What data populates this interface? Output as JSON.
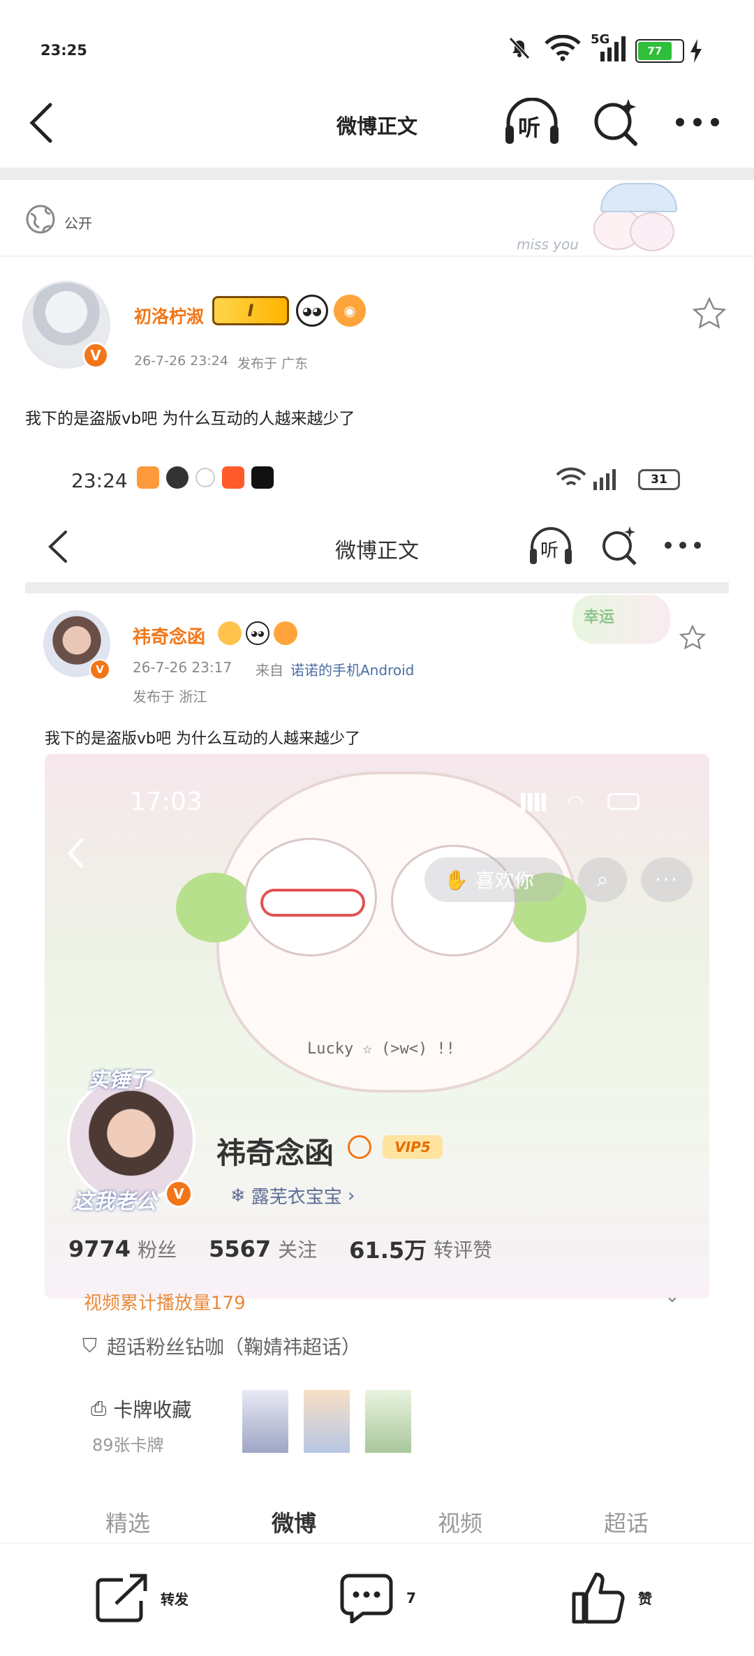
{
  "status_bar": {
    "time": "23:25",
    "network": "5G",
    "battery": "77"
  },
  "nav": {
    "title": "微博正文",
    "listen_label": "听"
  },
  "privacy": {
    "label": "公开",
    "sticker_text": "miss you"
  },
  "post": {
    "username": "初洛柠淑",
    "badge_level": "I",
    "timestamp": "26-7-26 23:24",
    "location": "发布于 广东",
    "text": "我下的是盗版vb吧 为什么互动的人越来越少了"
  },
  "inner": {
    "status_time": "23:24",
    "battery": "31",
    "nav_title": "微博正文",
    "listen_label": "听",
    "sticker_text": "幸运",
    "username": "祎奇念函",
    "timestamp": "26-7-26 23:17",
    "from_label": "来自",
    "device": "诺诺的手机Android",
    "location": "发布于 浙江",
    "text": "我下的是盗版vb吧 为什么互动的人越来越少了"
  },
  "profile": {
    "status_time": "17:03",
    "like_button": "喜欢你",
    "cloud_text": "Lucky ☆ (>w<) !!",
    "avatar_text_top": "实锤了",
    "avatar_text_bottom": "这我老公",
    "name": "祎奇念函",
    "vip": "VIP5",
    "subtitle": "露芜衣宝宝",
    "fans_count": "9774",
    "fans_label": "粉丝",
    "follow_count": "5567",
    "follow_label": "关注",
    "interact_count": "61.5万",
    "interact_label": "转评赞",
    "video_plays": "视频累计播放量179",
    "supertopic": "超话粉丝钻咖（鞠婧祎超话）",
    "card_title": "卡牌收藏",
    "card_count": "89张卡牌",
    "tabs": [
      "精选",
      "微博",
      "视频",
      "超话"
    ]
  },
  "actions": {
    "share": "转发",
    "comment_count": "7",
    "like": "赞"
  },
  "colors": {
    "accent": "#f27618",
    "link": "#4a6fa5",
    "green_battery": "#2fbf3a"
  }
}
